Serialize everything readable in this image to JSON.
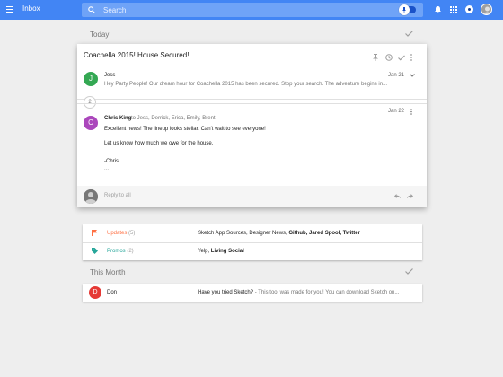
{
  "app": {
    "title": "Inbox"
  },
  "search": {
    "placeholder": "Search"
  },
  "sections": {
    "today": "Today",
    "this_month": "This Month"
  },
  "thread": {
    "subject": "Coachella 2015! House Secured!",
    "messages": [
      {
        "initial": "J",
        "avatar_color": "#34a853",
        "sender": "Jess",
        "snippet": "Hey Party People! Our dream hour for Coachella 2015 has been secured. Stop your search. The adventure begins in...",
        "date": "Jan 21"
      },
      {
        "initial": "C",
        "avatar_color": "#ab47bc",
        "sender": "Chris King",
        "recipients": "to Jess, Derrick, Erica, Emily, Brent",
        "date": "Jan 22",
        "body": [
          "Excellent news! The lineup looks stellar. Can't wait to see everyone!",
          "Let us know how much we owe for the house.",
          "-Chris",
          "..."
        ]
      }
    ],
    "collapsed_count": "2",
    "reply_label": "Reply to all"
  },
  "bundles": [
    {
      "name": "Updates",
      "count": "(5)",
      "color": "#ff7043",
      "icon": "flag-icon",
      "senders_plain": "Sketch App Sources, Designer News, ",
      "senders_bold": "Github, Jared Spool, Twitter"
    },
    {
      "name": "Promos",
      "count": "(2)",
      "color": "#26a69a",
      "icon": "tag-icon",
      "senders_plain": "Yelp, ",
      "senders_bold": "Living Social"
    }
  ],
  "month_item": {
    "initial": "D",
    "avatar_color": "#e53935",
    "sender": "Don",
    "subject": "Have you tried Sketch?",
    "snippet": " - This tool was made for you! You can download Sketch on..."
  },
  "colors": {
    "topbar": "#4285f4",
    "accent": "#1a52c9"
  }
}
